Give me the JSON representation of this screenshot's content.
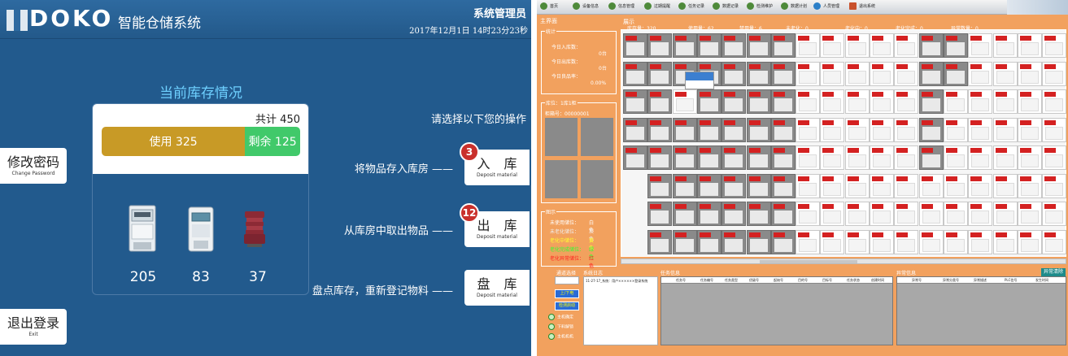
{
  "left": {
    "logo": "DOKO",
    "system_name": "智能仓储系统",
    "user_role": "系统管理员",
    "datetime": "2017年12月1日  14时23分23秒",
    "inventory_title": "当前库存情况",
    "total_label": "共计 450",
    "used_label": "使用 325",
    "free_label": "剩余 125",
    "used_fraction": 0.722,
    "items": [
      {
        "icon": "electric-meter-icon",
        "count": "205"
      },
      {
        "icon": "digital-meter-icon",
        "count": "83"
      },
      {
        "icon": "transformer-icon",
        "count": "37"
      }
    ],
    "change_password": {
      "label": "修改密码",
      "sub": "Change Password"
    },
    "logout": {
      "label": "退出登录",
      "sub": "Exit"
    },
    "operation_prompt": "请选择以下您的操作",
    "operations": [
      {
        "desc": "将物品存入库房 ——",
        "label": "入 库",
        "sub": "Deposit material",
        "badge": "3"
      },
      {
        "desc": "从库房中取出物品 ——",
        "label": "出 库",
        "sub": "Deposit material",
        "badge": "12"
      },
      {
        "desc": "盘点库存，重新登记物料 ——",
        "label": "盘 库",
        "sub": "Deposit material",
        "badge": ""
      }
    ]
  },
  "right": {
    "toolbar": [
      "首页",
      "设备信息",
      "信息管理",
      "过期提醒",
      "任务记录",
      "数据记录",
      "检测维护",
      "数据计划",
      "人员管理",
      "退出系统"
    ],
    "main_title": "主界面",
    "stats": {
      "title": "统计",
      "today_in": "今日入库数：",
      "today_in_value": "0台",
      "today_out": "今日出库数：",
      "today_out_value": "0台",
      "today_rate": "今日良品率：",
      "today_rate_value": "0.00%"
    },
    "slot_section": {
      "title": "库位：1库1柜",
      "box_id": "柜箱号：00000001"
    },
    "legend": {
      "title": "图示",
      "rows": [
        {
          "label": "未使用储位：",
          "value": "白色",
          "color": "#ffffff"
        },
        {
          "label": "未老化储位：",
          "value": "灰色",
          "color": "#f0f0f0"
        },
        {
          "label": "老化中储位：",
          "value": "黄色",
          "color": "#ffff33"
        },
        {
          "label": "老化完成储位：",
          "value": "绿色",
          "color": "#33ff33"
        },
        {
          "label": "老化异常储位：",
          "value": "红色",
          "color": "#ff2222"
        }
      ]
    },
    "grid_header": {
      "title": "展示",
      "stock": "库存量：320",
      "used": "使用量：62",
      "disabled": "禁用量：6",
      "not_aged": "未老化：0",
      "aging": "老化中：0",
      "aged": "老化完成：0",
      "abnormal": "异常数量：0"
    },
    "bottom": {
      "device_select": "通道选择",
      "log_title": "系统日志",
      "log_entry": "11-27-17_系统：用户××××××登录系统",
      "up_down": "上/下电",
      "start_test": "检测启动",
      "motor_ok": "主机确定",
      "motor_release": "下料解锁",
      "robot": "主机机机",
      "task_title": "任务信息",
      "abnormal_title": "异常信息",
      "clear_abnormal": "异常清除",
      "task_cols": [
        "任务号",
        "任务编号",
        "任务类型",
        "优级号",
        "起始号",
        "目的号",
        "目标号",
        "任务状态",
        "创建时间"
      ],
      "abnormal_cols": [
        "异常号",
        "异常分类号",
        "异常描述",
        "PLC信号",
        "发生时间"
      ]
    }
  }
}
